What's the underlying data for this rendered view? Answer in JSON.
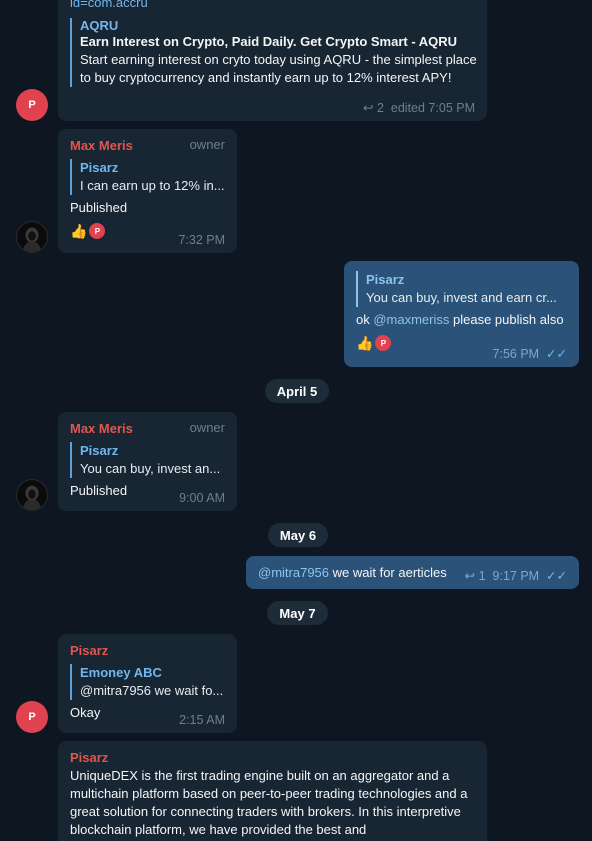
{
  "msg1": {
    "link_partial": "id=com.accru",
    "preview_site": "AQRU",
    "preview_title": "Earn Interest on Crypto, Paid Daily. Get Crypto Smart - AQRU",
    "preview_desc": "Start earning interest on cryto today using AQRU - the simplest place to buy cryptocurrency and instantly earn up to 12% interest APY!",
    "replies": "2",
    "time": "edited 7:05 PM",
    "avatar_letter": "P"
  },
  "msg2": {
    "sender": "Max Meris",
    "role": "owner",
    "quote_name": "Pisarz",
    "quote_text": "I can earn up to 12% in...",
    "text": "Published",
    "time": "7:32 PM",
    "reaction_letter": "P"
  },
  "msg3": {
    "quote_name": "Pisarz",
    "quote_text": "You can buy, invest and earn cr...",
    "text_before": "ok ",
    "mention": "@maxmeriss",
    "text_after": " please publish also",
    "time": "7:56 PM",
    "reaction_letter": "P"
  },
  "date1": "April 5",
  "msg4": {
    "sender": "Max Meris",
    "role": "owner",
    "quote_name": "Pisarz",
    "quote_text": "You can buy, invest an...",
    "text": "Published",
    "time": "9:00 AM"
  },
  "date2": "May 6",
  "msg5": {
    "mention": "@mitra7956",
    "text": " we wait for aerticles",
    "replies": "1",
    "time": "9:17 PM"
  },
  "date3": "May 7",
  "msg6": {
    "sender": "Pisarz",
    "quote_name": "Emoney ABC",
    "quote_text": "@mitra7956 we wait fo...",
    "text": "Okay",
    "time": "2:15 AM",
    "avatar_letter": "P"
  },
  "msg7": {
    "sender": "Pisarz",
    "text": "UniqueDEX is the first trading engine built on an aggregator and a multichain platform based on peer-to-peer trading technologies and a great solution for connecting traders with brokers. In this interpretive blockchain platform, we have provided the best and"
  },
  "colors": {
    "background": "#0e1621",
    "bubble_in": "#182533",
    "bubble_out": "#2b5278",
    "accent": "#71b7ef",
    "sender_red": "#e2564e"
  }
}
